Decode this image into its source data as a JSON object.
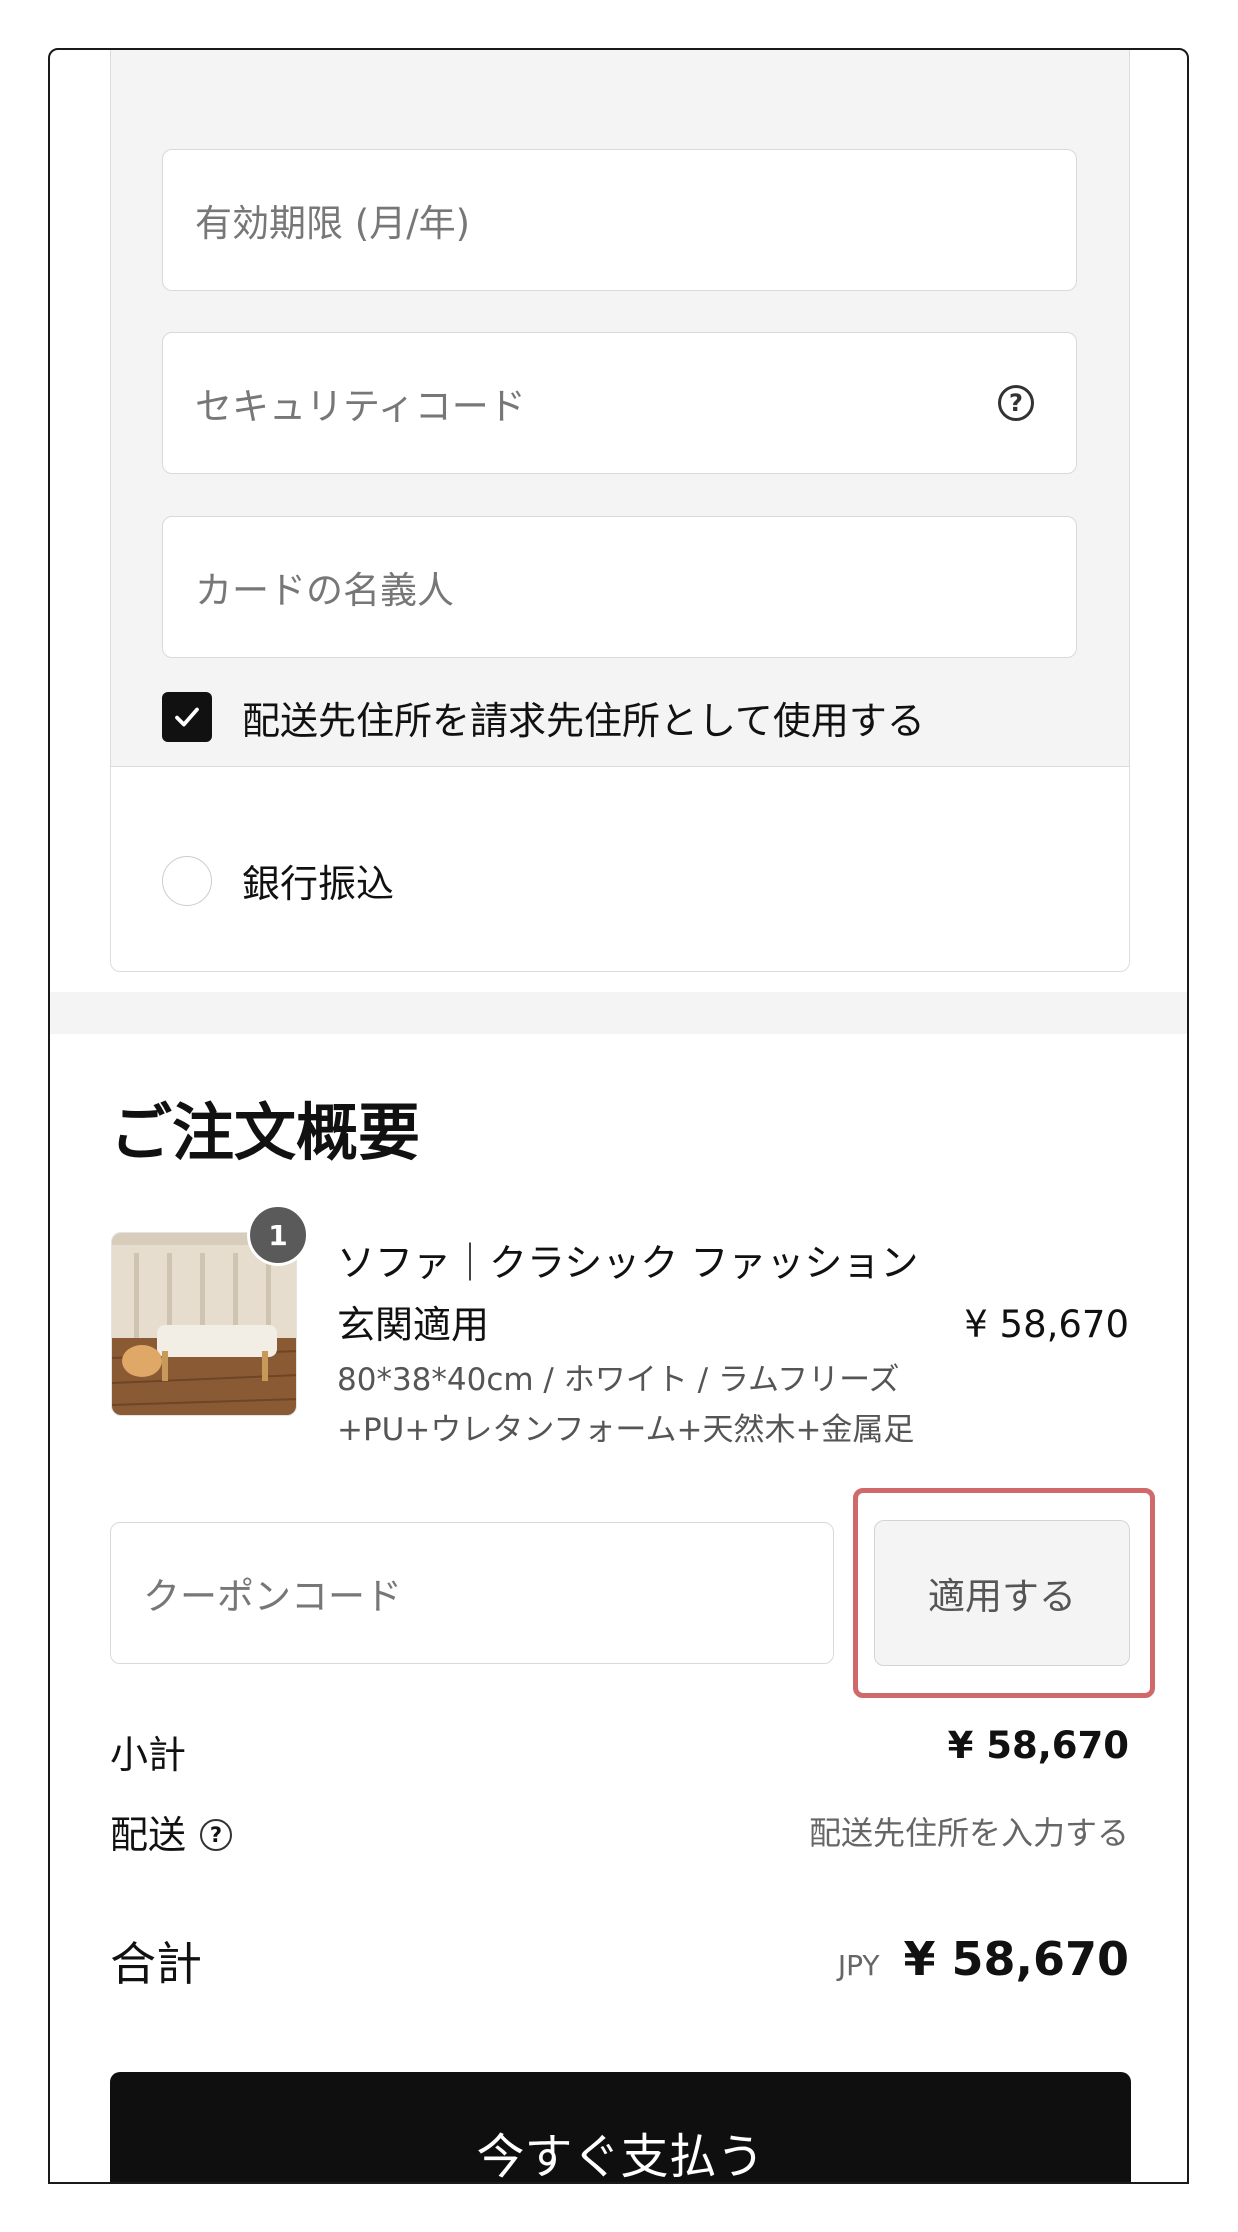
{
  "payment": {
    "expiry_placeholder": "有効期限 (月/年)",
    "security_code_placeholder": "セキュリティコード",
    "cardholder_placeholder": "カードの名義人",
    "billing_same_label": "配送先住所を請求先住所として使用する",
    "billing_same_checked": true,
    "bank_transfer_label": "銀行振込"
  },
  "summary": {
    "title": "ご注文概要",
    "item": {
      "quantity": "1",
      "name": "ソファ｜クラシック ファッション 玄関適用",
      "price": "¥ 58,670",
      "variant": "80*38*40cm / ホワイト / ラムフリーズ +PU+ウレタンフォーム+天然木+金属足"
    },
    "coupon_placeholder": "クーポンコード",
    "apply_label": "適用する",
    "subtotal_label": "小計",
    "subtotal_value": "¥ 58,670",
    "shipping_label": "配送",
    "shipping_value": "配送先住所を入力する",
    "total_label": "合計",
    "total_currency": "JPY",
    "total_value": "¥ 58,670",
    "pay_button_label": "今すぐ支払う"
  },
  "icons": {
    "help": "question-circle-icon",
    "check": "checkmark-icon"
  },
  "colors": {
    "highlight": "#d06a6a",
    "pay_button_bg": "#0f0f0f",
    "panel_bg": "#f4f4f4"
  }
}
